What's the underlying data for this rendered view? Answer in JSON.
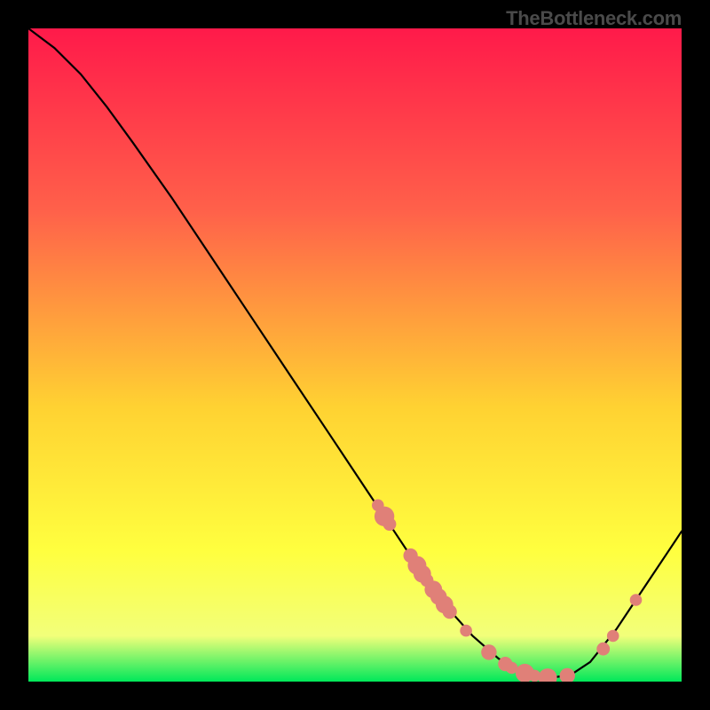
{
  "watermark": "TheBottleneck.com",
  "colors": {
    "gradient_top": "#ff1a4a",
    "gradient_mid1": "#ff614a",
    "gradient_mid2": "#ffd232",
    "gradient_mid3": "#ffff3f",
    "gradient_mid4": "#f2ff7a",
    "gradient_bottom": "#00e85a",
    "curve": "#000000",
    "marker_fill": "#e08078",
    "marker_stroke": "#d46a62"
  },
  "chart_data": {
    "type": "line",
    "title": "",
    "xlabel": "",
    "ylabel": "",
    "xlim": [
      0,
      100
    ],
    "ylim": [
      0,
      100
    ],
    "curve": [
      {
        "x": 0,
        "y": 100
      },
      {
        "x": 4,
        "y": 97
      },
      {
        "x": 8,
        "y": 93
      },
      {
        "x": 12,
        "y": 88
      },
      {
        "x": 16,
        "y": 82.5
      },
      {
        "x": 22,
        "y": 74
      },
      {
        "x": 28,
        "y": 65
      },
      {
        "x": 34,
        "y": 56
      },
      {
        "x": 40,
        "y": 47
      },
      {
        "x": 46,
        "y": 38
      },
      {
        "x": 52,
        "y": 29
      },
      {
        "x": 56,
        "y": 23
      },
      {
        "x": 60,
        "y": 17
      },
      {
        "x": 64,
        "y": 11.5
      },
      {
        "x": 68,
        "y": 7
      },
      {
        "x": 72,
        "y": 3.5
      },
      {
        "x": 76,
        "y": 1.3
      },
      {
        "x": 80,
        "y": 0.6
      },
      {
        "x": 83,
        "y": 1.0
      },
      {
        "x": 86,
        "y": 3
      },
      {
        "x": 90,
        "y": 8
      },
      {
        "x": 94,
        "y": 14
      },
      {
        "x": 98,
        "y": 20
      },
      {
        "x": 100,
        "y": 23
      }
    ],
    "markers": [
      {
        "x": 53.5,
        "y": 27,
        "r": 1.1
      },
      {
        "x": 54.5,
        "y": 25.3,
        "r": 1.8
      },
      {
        "x": 55.3,
        "y": 24.1,
        "r": 1.2
      },
      {
        "x": 58.5,
        "y": 19.3,
        "r": 1.3
      },
      {
        "x": 59.5,
        "y": 17.8,
        "r": 1.7
      },
      {
        "x": 60.3,
        "y": 16.5,
        "r": 1.6
      },
      {
        "x": 61.0,
        "y": 15.5,
        "r": 1.2
      },
      {
        "x": 62.0,
        "y": 14.1,
        "r": 1.6
      },
      {
        "x": 62.8,
        "y": 13.0,
        "r": 1.5
      },
      {
        "x": 63.7,
        "y": 11.8,
        "r": 1.6
      },
      {
        "x": 64.5,
        "y": 10.7,
        "r": 1.3
      },
      {
        "x": 67.0,
        "y": 7.8,
        "r": 1.1
      },
      {
        "x": 70.5,
        "y": 4.5,
        "r": 1.4
      },
      {
        "x": 73.0,
        "y": 2.7,
        "r": 1.3
      },
      {
        "x": 74.0,
        "y": 2.1,
        "r": 1.1
      },
      {
        "x": 76.0,
        "y": 1.3,
        "r": 1.7
      },
      {
        "x": 77.5,
        "y": 0.9,
        "r": 1.1
      },
      {
        "x": 79.5,
        "y": 0.6,
        "r": 1.7
      },
      {
        "x": 82.5,
        "y": 0.9,
        "r": 1.4
      },
      {
        "x": 88.0,
        "y": 5.0,
        "r": 1.2
      },
      {
        "x": 89.5,
        "y": 7.0,
        "r": 1.1
      },
      {
        "x": 93.0,
        "y": 12.5,
        "r": 1.1
      }
    ]
  }
}
